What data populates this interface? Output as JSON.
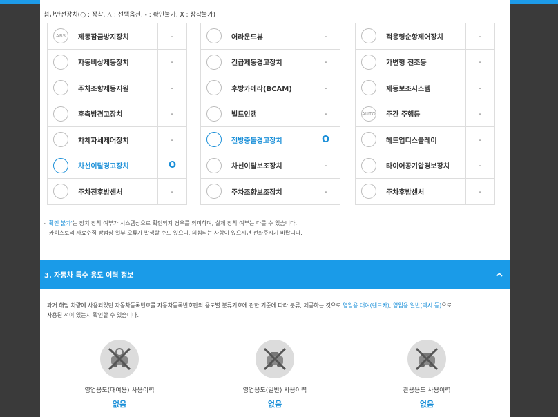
{
  "legend": "첨단안전장치(○ : 장착, △ : 선택옵션, - : 확인불가, X : 장착불가)",
  "columns": [
    [
      {
        "icon": "abs-icon",
        "icon_text": "ABS",
        "name": "제동잠금방지장치",
        "status": "-",
        "highlight": false
      },
      {
        "icon": "emergency-brake-icon",
        "icon_text": "",
        "name": "자동비상제동장치",
        "status": "-",
        "highlight": false
      },
      {
        "icon": "parking-brake-icon",
        "icon_text": "",
        "name": "주차조향제동지원",
        "status": "-",
        "highlight": false
      },
      {
        "icon": "rear-warning-icon",
        "icon_text": "",
        "name": "후측방경고장치",
        "status": "-",
        "highlight": false
      },
      {
        "icon": "stability-control-icon",
        "icon_text": "",
        "name": "차체자세제어장치",
        "status": "-",
        "highlight": false
      },
      {
        "icon": "lane-departure-icon",
        "icon_text": "",
        "name": "차선이탈경고장치",
        "status": "O",
        "highlight": true
      },
      {
        "icon": "parking-sensor-icon",
        "icon_text": "",
        "name": "주차전후방센서",
        "status": "-",
        "highlight": false
      }
    ],
    [
      {
        "icon": "around-view-icon",
        "icon_text": "",
        "name": "어라운드뷰",
        "status": "-",
        "highlight": false
      },
      {
        "icon": "emergency-brake-warning-icon",
        "icon_text": "",
        "name": "긴급제동경고장치",
        "status": "-",
        "highlight": false
      },
      {
        "icon": "rear-camera-icon",
        "icon_text": "",
        "name": "후방카메라(BCAM)",
        "status": "-",
        "highlight": false
      },
      {
        "icon": "dashcam-icon",
        "icon_text": "",
        "name": "빌트인캠",
        "status": "-",
        "highlight": false
      },
      {
        "icon": "forward-collision-icon",
        "icon_text": "",
        "name": "전방충돌경고장치",
        "status": "O",
        "highlight": true
      },
      {
        "icon": "lane-assist-icon",
        "icon_text": "",
        "name": "차선이탈보조장치",
        "status": "-",
        "highlight": false
      },
      {
        "icon": "parking-assist-icon",
        "icon_text": "",
        "name": "주차조향보조장치",
        "status": "-",
        "highlight": false
      }
    ],
    [
      {
        "icon": "adaptive-cruise-icon",
        "icon_text": "",
        "name": "적응형순항제어장치",
        "status": "-",
        "highlight": false
      },
      {
        "icon": "adaptive-headlight-icon",
        "icon_text": "",
        "name": "가변형 전조등",
        "status": "-",
        "highlight": false
      },
      {
        "icon": "brake-assist-icon",
        "icon_text": "",
        "name": "제동보조시스템",
        "status": "-",
        "highlight": false
      },
      {
        "icon": "daytime-light-icon",
        "icon_text": "AUTO",
        "name": "주간 주행등",
        "status": "-",
        "highlight": false
      },
      {
        "icon": "head-up-display-icon",
        "icon_text": "",
        "name": "헤드업디스플레이",
        "status": "-",
        "highlight": false
      },
      {
        "icon": "tire-pressure-icon",
        "icon_text": "",
        "name": "타이어공기압경보장치",
        "status": "-",
        "highlight": false
      },
      {
        "icon": "rear-sensor-icon",
        "icon_text": "",
        "name": "주차후방센서",
        "status": "-",
        "highlight": false
      }
    ]
  ],
  "note": {
    "prefix": "- ",
    "highlight": "'확인 불가'",
    "line1_rest": "는 장치 장착 여부가 시스템상으로 확인되지 경우를 의미하며, 실제 장착 여부는 다를 수 있습니다.",
    "line2": "카히스토리 자료수집 방법상 일부 오류가 발생할 수도 있으니, 의심되는 사항이 있으시면 전화주시기 바랍니다."
  },
  "section": {
    "title": "3. 자동차 특수 용도 이력 정보",
    "chevron": "^"
  },
  "description": {
    "part1": "과거 해당 차량에 사용되었던 자동차등록번호를 자동차등록번호판의 용도별 분류기호에 관한 기준에 따라 분류, 제공하는 것으로 ",
    "link1": "영업용 대여(렌트카)",
    "sep": ", ",
    "link2": "영업용 일반(택시 등)",
    "part2": "으로",
    "line2": "사용된 적이 있는지 확인할 수 있습니다."
  },
  "usage": [
    {
      "icon": "rental-car-icon",
      "label": "영업용도(대여용) 사용이력",
      "value": "없음"
    },
    {
      "icon": "taxi-icon",
      "label": "영업용도(일반) 사용이력",
      "value": "없음"
    },
    {
      "icon": "government-car-icon",
      "label": "관용용도 사용이력",
      "value": "없음"
    }
  ]
}
